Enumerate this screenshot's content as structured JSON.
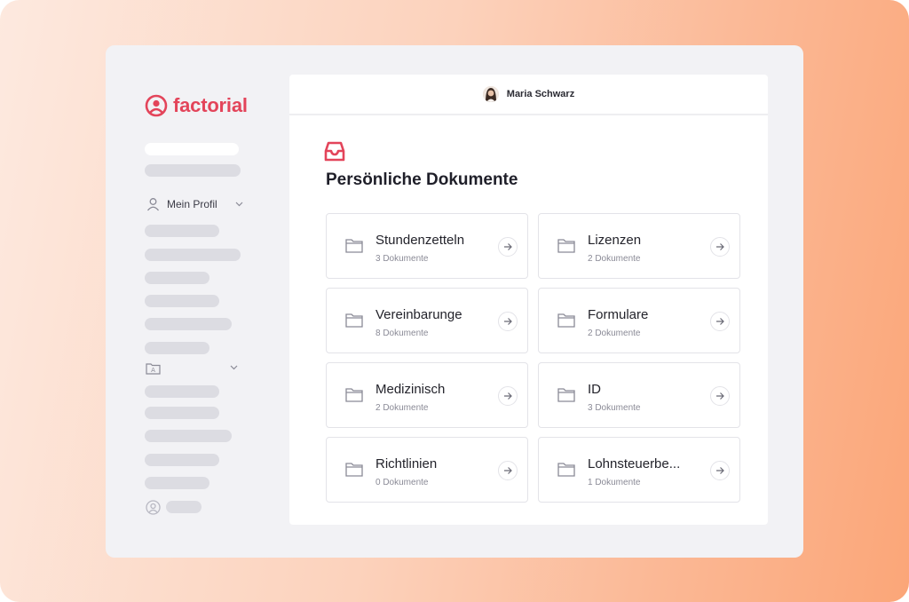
{
  "app": {
    "brand": "factorial",
    "brand_color": "#e3445a"
  },
  "sidebar": {
    "profile_label": "Mein Profil",
    "profile_icon": "user-icon",
    "documents_icon": "folder-person-icon"
  },
  "header": {
    "user_name": "Maria Schwarz"
  },
  "main": {
    "title": "Persönliche Dokumente",
    "title_icon": "inbox-icon",
    "folders": [
      {
        "name": "Stundenzetteln",
        "count": "3 Dokumente"
      },
      {
        "name": "Lizenzen",
        "count": "2 Dokumente"
      },
      {
        "name": "Vereinbarunge",
        "count": "8 Dokumente"
      },
      {
        "name": "Formulare",
        "count": "2 Dokumente"
      },
      {
        "name": "Medizinisch",
        "count": "2 Dokumente"
      },
      {
        "name": "ID",
        "count": "3 Dokumente"
      },
      {
        "name": "Richtlinien",
        "count": "0 Dokumente"
      },
      {
        "name": "Lohnsteuerbe...",
        "count": "1 Dokumente"
      }
    ]
  }
}
